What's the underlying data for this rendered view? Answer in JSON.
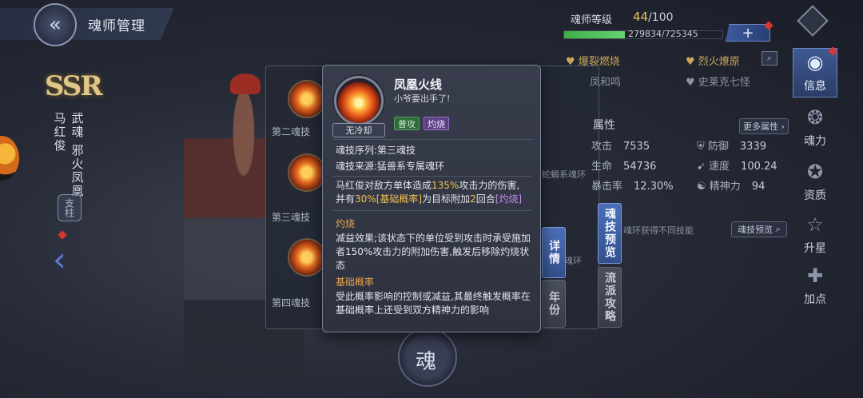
{
  "header": {
    "title": "魂师管理",
    "back_icon": "back-arrow-icon"
  },
  "character": {
    "rarity": "SSR",
    "name": "马红俊",
    "martial_soul_label": "武魂",
    "martial_soul": "邪火凤凰",
    "type_tag": "支柱"
  },
  "skill_list": [
    {
      "label": "第二魂技"
    },
    {
      "label": "第三魂技"
    },
    {
      "label": "第四魂技"
    }
  ],
  "soul_button": "魂",
  "level": {
    "label": "魂师等级",
    "current": "44",
    "max": "/100",
    "xp_text": "279834/725345",
    "xp_fraction": 0.386,
    "plus": "+"
  },
  "abilities": {
    "a1": "爆裂燃烧",
    "a2": "烈火燎原",
    "a3": "凤和鸣",
    "a4": "史莱克七怪"
  },
  "attributes": {
    "title": "属性",
    "more": "更多属性 ›",
    "rows": [
      {
        "label": "攻击",
        "value": "7535"
      },
      {
        "label": "防御",
        "value": "3339"
      },
      {
        "label": "生命",
        "value": "54736"
      },
      {
        "label": "速度",
        "value": "100.24"
      },
      {
        "label": "暴击率",
        "value": "12.30%"
      },
      {
        "label": "精神力",
        "value": "94"
      }
    ]
  },
  "panel_texts": {
    "ring_source": "蛇蝎系魂环",
    "ring_source2": "魂环",
    "ring_hint": "魂环获得不同技能",
    "preview_btn": "魂技预览"
  },
  "tabs": {
    "detail": "详情",
    "year": "年份",
    "skill_preview": "魂技预览",
    "school_strategy": "流派攻略"
  },
  "nav": [
    {
      "label": "信息",
      "icon": "info-icon",
      "active": true
    },
    {
      "label": "魂力",
      "icon": "soul-power-icon"
    },
    {
      "label": "资质",
      "icon": "aptitude-icon"
    },
    {
      "label": "升星",
      "icon": "star-up-icon"
    },
    {
      "label": "加点",
      "icon": "add-point-icon"
    }
  ],
  "popup": {
    "skill_name": "凤凰火线",
    "quote": "小爷要出手了!",
    "cooldown": "无冷却",
    "tag_normal": "普攻",
    "tag_burn": "灼烧",
    "seq_label": "魂技序列:第三魂技",
    "source_label": "魂技来源:猛兽系专属魂环",
    "desc_1a": "马红俊对敌方单体造成",
    "desc_1b": "135%",
    "desc_1c": "攻击力的伤害,",
    "desc_2a": "并有",
    "desc_2b": "30%[基础概率]",
    "desc_2c": "为目标附加",
    "desc_2d": "2",
    "desc_2e": "回合",
    "desc_2f": "[灼烧]",
    "burn_title": "灼烧",
    "burn_desc": "减益效果;该状态下的单位受到攻击时承受施加者150%攻击力的附加伤害,触发后移除灼烧状态",
    "rate_title": "基础概率",
    "rate_desc": "受此概率影响的控制或减益,其最终触发概率在基础概率上还受到双方精神力的影响"
  },
  "colors": {
    "accent_blue": "#4a6fb8",
    "highlight_yellow": "#f0c24c",
    "highlight_purple": "#c88cf0",
    "section_orange": "#e8a44a",
    "xp_green": "#3fae4a"
  }
}
